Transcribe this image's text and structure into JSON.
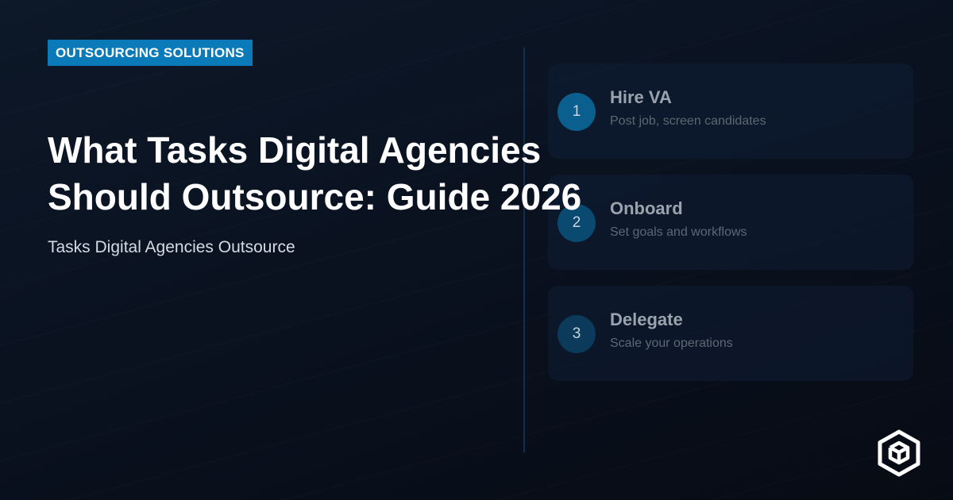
{
  "badge": "OUTSOURCING SOLUTIONS",
  "title_line1": "What Tasks Digital Agencies",
  "title_line2": "Should Outsource: Guide 2026",
  "subtitle": "Tasks Digital Agencies Outsource",
  "steps": [
    {
      "number": "1",
      "title": "Hire VA",
      "desc": "Post job, screen candidates",
      "circle_color": "#0a5f8e"
    },
    {
      "number": "2",
      "title": "Onboard",
      "desc": "Set goals and workflows",
      "circle_color": "#0a4a70"
    },
    {
      "number": "3",
      "title": "Delegate",
      "desc": "Scale your operations",
      "circle_color": "#0b3a5a"
    }
  ],
  "colors": {
    "badge_bg": "#0a7bb8",
    "background": "#0a1220",
    "divider": "#12304a"
  },
  "logo_icon": "cube-hexagon-icon"
}
